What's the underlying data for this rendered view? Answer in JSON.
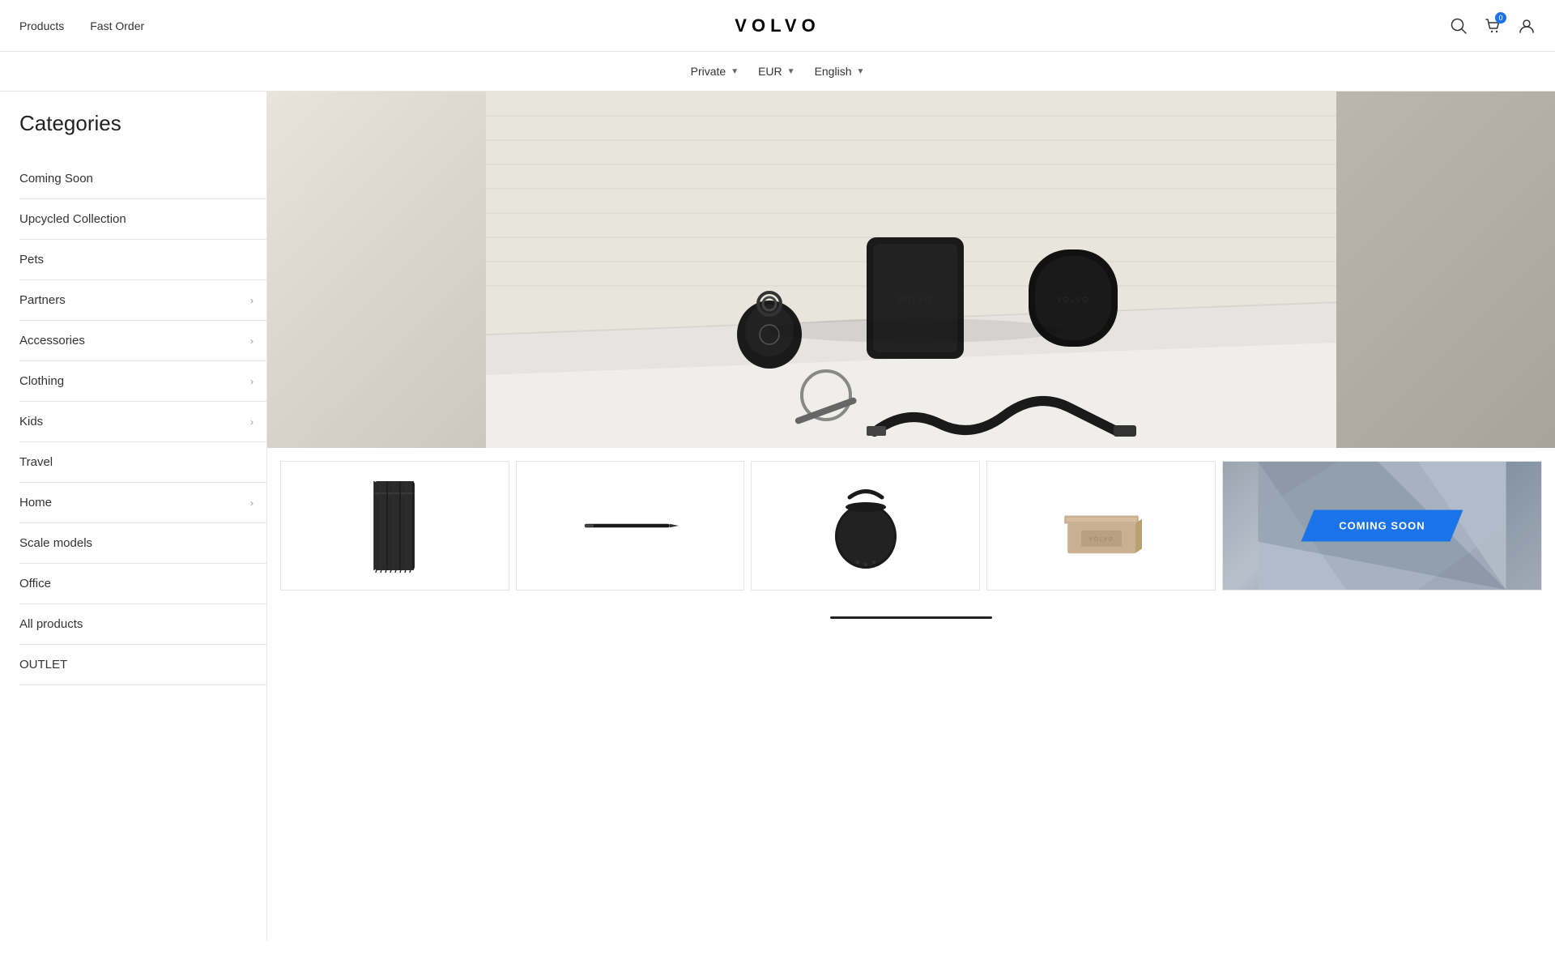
{
  "header": {
    "products_label": "Products",
    "fast_order_label": "Fast Order",
    "logo_text": "VOLVO",
    "cart_badge": "0"
  },
  "sub_header": {
    "private_label": "Private",
    "eur_label": "EUR",
    "english_label": "English"
  },
  "sidebar": {
    "title": "Categories",
    "items": [
      {
        "label": "Coming Soon",
        "has_children": false
      },
      {
        "label": "Upcycled Collection",
        "has_children": false
      },
      {
        "label": "Pets",
        "has_children": false
      },
      {
        "label": "Partners",
        "has_children": true
      },
      {
        "label": "Accessories",
        "has_children": true
      },
      {
        "label": "Clothing",
        "has_children": true
      },
      {
        "label": "Kids",
        "has_children": true
      },
      {
        "label": "Travel",
        "has_children": false
      },
      {
        "label": "Home",
        "has_children": true
      },
      {
        "label": "Scale models",
        "has_children": false
      },
      {
        "label": "Office",
        "has_children": false
      },
      {
        "label": "All products",
        "has_children": false
      },
      {
        "label": "OUTLET",
        "has_children": false
      }
    ]
  },
  "coming_soon_banner": "COMING SOON",
  "scroll_indicator": true
}
